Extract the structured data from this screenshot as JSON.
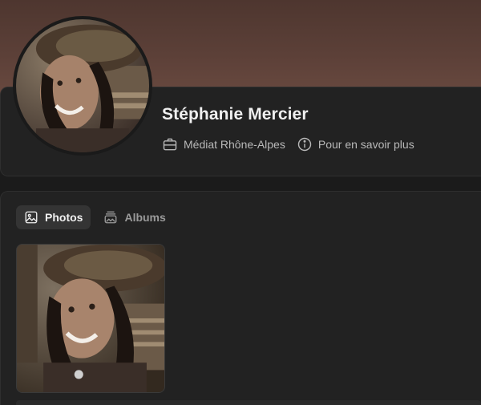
{
  "profile": {
    "name": "Stéphanie Mercier",
    "organization": "Médiat Rhône-Alpes",
    "more_info": "Pour en savoir plus",
    "organization_icon": "briefcase-icon",
    "more_info_icon": "info-circle-icon"
  },
  "tabs": [
    {
      "label": "Photos",
      "icon": "image-icon",
      "active": true
    },
    {
      "label": "Albums",
      "icon": "albums-icon",
      "active": false
    }
  ],
  "colors": {
    "cover": "#5c4038",
    "card": "#222222",
    "active_tab": "#343434"
  }
}
